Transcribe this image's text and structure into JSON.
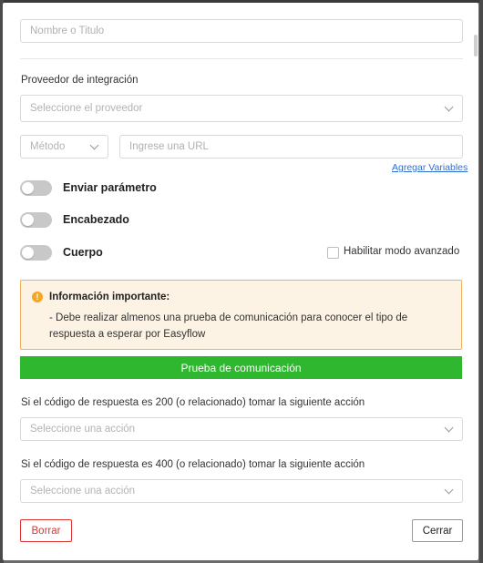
{
  "form": {
    "name_placeholder": "Nombre o Titulo",
    "provider_label": "Proveedor de integración",
    "provider_placeholder": "Seleccione el proveedor",
    "method_placeholder": "Método",
    "url_placeholder": "Ingrese una URL",
    "add_variables_link": "Agregar Variables"
  },
  "toggles": [
    {
      "label": "Enviar parámetro",
      "on": false
    },
    {
      "label": "Encabezado",
      "on": false
    },
    {
      "label": "Cuerpo",
      "on": false
    }
  ],
  "advanced": {
    "label": "Habilitar modo avanzado",
    "checked": false
  },
  "alert": {
    "icon": "info-icon",
    "title": "Información importante:",
    "body": "- Debe realizar almenos una prueba de comunicación para conocer el tipo de respuesta a esperar por Easyflow"
  },
  "test_button": "Prueba de comunicación",
  "response200": {
    "label": "Si el código de respuesta es 200 (o relacionado) tomar la siguiente acción",
    "placeholder": "Seleccione una acción"
  },
  "response400": {
    "label": "Si el código de respuesta es 400 (o relacionado) tomar la siguiente acción",
    "placeholder": "Seleccione una acción"
  },
  "footer": {
    "delete_label": "Borrar",
    "close_label": "Cerrar"
  },
  "colors": {
    "success": "#2fb72f",
    "danger": "#dd3333",
    "warning_border": "#f0b25b",
    "warning_bg": "#fdf3e4",
    "link": "#2f6fd1"
  }
}
